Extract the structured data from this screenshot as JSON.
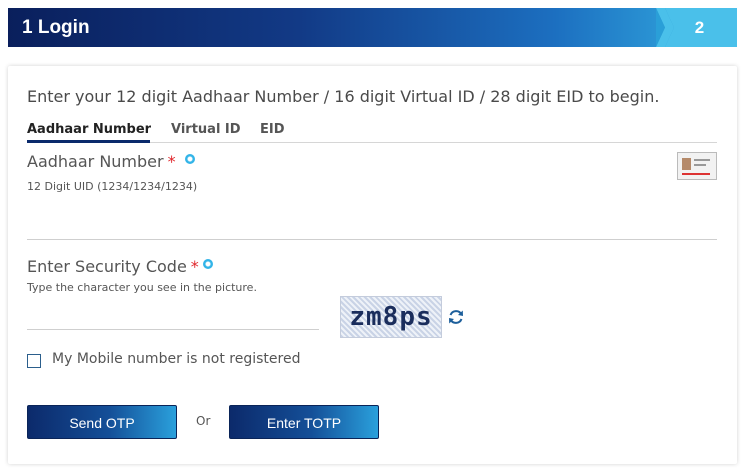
{
  "steps": {
    "step1_label": "1 Login",
    "step2_label": "2"
  },
  "intro": "Enter your 12 digit Aadhaar Number / 16 digit Virtual ID / 28 digit EID to begin.",
  "tabs": [
    {
      "label": "Aadhaar Number",
      "active": true
    },
    {
      "label": "Virtual ID",
      "active": false
    },
    {
      "label": "EID",
      "active": false
    }
  ],
  "aadhaar_field": {
    "label": "Aadhaar Number",
    "required_mark": "*",
    "hint": "12 Digit UID (1234/1234/1234)",
    "value": "",
    "icon": "info-icon",
    "card_image": "aadhaar-card-image"
  },
  "security_field": {
    "label": "Enter Security Code",
    "required_mark": "*",
    "hint": "Type the character you see in the picture.",
    "value": "",
    "captcha_text": "zm8ps",
    "refresh_icon": "refresh-icon"
  },
  "mobile_checkbox": {
    "label": "My Mobile number is not registered",
    "checked": false
  },
  "buttons": {
    "send_otp": "Send OTP",
    "or": "Or",
    "enter_totp": "Enter TOTP"
  },
  "colors": {
    "header_dark": "#0a1f5c",
    "header_light": "#35b0e3",
    "required": "#e0262b",
    "info": "#32b4e8"
  }
}
